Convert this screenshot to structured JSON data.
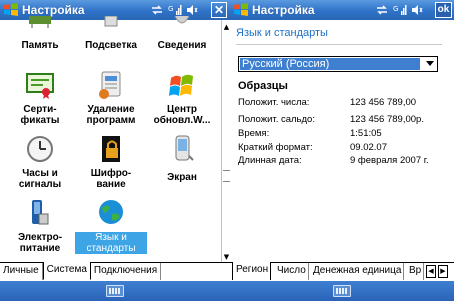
{
  "left": {
    "title": "Настройка",
    "close_label": "✕",
    "icons": [
      {
        "label": "Память",
        "icon": "memory-icon"
      },
      {
        "label": "Подсветка",
        "icon": "backlight-icon"
      },
      {
        "label": "Сведения",
        "icon": "about-icon"
      },
      {
        "label": "Серти-\nфикаты",
        "icon": "certificates-icon"
      },
      {
        "label": "Удаление\nпрограмм",
        "icon": "remove-programs-icon"
      },
      {
        "label": "Центр\nобновл.W...",
        "icon": "update-center-icon"
      },
      {
        "label": "Часы и\nсигналы",
        "icon": "clock-icon"
      },
      {
        "label": "Шифро-\nвание",
        "icon": "encryption-icon"
      },
      {
        "label": "Экран",
        "icon": "screen-icon"
      },
      {
        "label": "Электро-\nпитание",
        "icon": "power-icon"
      },
      {
        "label": "Язык и\nстандарты",
        "icon": "regional-settings-icon"
      }
    ],
    "tabs": [
      "Личные",
      "Система",
      "Подключения"
    ],
    "active_tab": "Система"
  },
  "right": {
    "title": "Настройка",
    "ok_label": "ok",
    "section_title": "Язык и стандарты",
    "locale_value": "Русский (Россия)",
    "samples_heading": "Образцы",
    "samples": [
      {
        "label": "Положит. числа:",
        "value": "123 456 789,00"
      },
      {
        "label": "Положит. сальдо:",
        "value": "123 456 789,00р."
      },
      {
        "label": "Время:",
        "value": "1:51:05"
      },
      {
        "label": "Краткий формат:",
        "value": "09.02.07"
      },
      {
        "label": "Длинная дата:",
        "value": "9 февраля 2007 г."
      }
    ],
    "tabs": [
      "Регион",
      "Число",
      "Денежная единица",
      "Вр"
    ],
    "active_tab": "Регион"
  },
  "colors": {
    "titlebar": "#2f73c9",
    "accent": "#1d6fc7",
    "selection": "#3e7fd0"
  }
}
